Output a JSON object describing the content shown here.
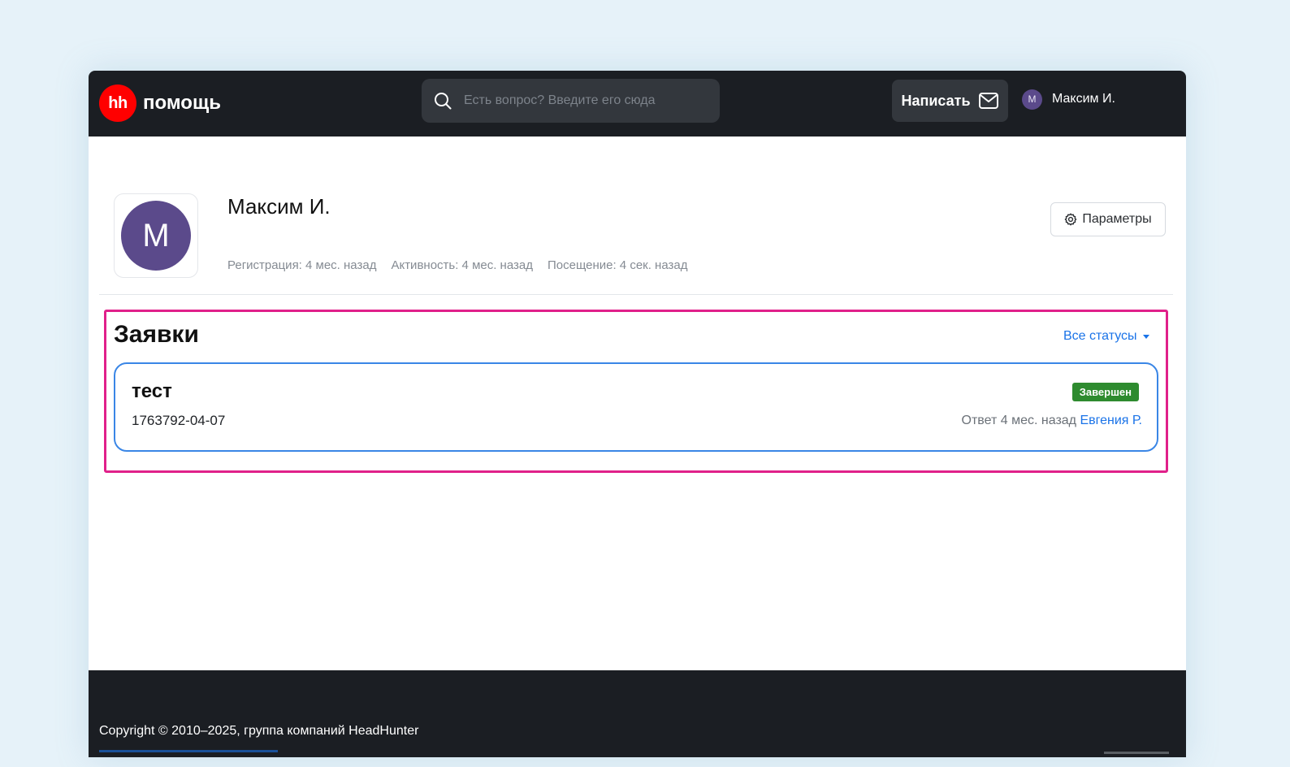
{
  "header": {
    "logo_mark": "hh",
    "logo_text": "помощь",
    "search_placeholder": "Есть вопрос? Введите его сюда",
    "write_label": "Написать",
    "user_initial": "М",
    "user_name": "Максим И."
  },
  "profile": {
    "avatar_letter": "M",
    "name": "Максим И.",
    "registration": "Регистрация: 4 мес. назад",
    "activity": "Активность: 4 мес. назад",
    "visit": "Посещение: 4 сек. назад",
    "params_label": "Параметры"
  },
  "tickets": {
    "title": "Заявки",
    "filter_label": "Все статусы",
    "items": [
      {
        "title": "тест",
        "id": "1763792-04-07",
        "status": "Завершен",
        "answer_prefix": "Ответ 4 мес. назад",
        "agent": "Евгения Р."
      }
    ]
  },
  "footer": {
    "copyright": "Copyright © 2010–2025, группа компаний HeadHunter"
  },
  "colors": {
    "brand": "#ff0000",
    "header_bg": "#1b1e23",
    "accent_link": "#1a73e8",
    "status_done": "#2e8b2f",
    "highlight": "#e0208a",
    "avatar": "#5b4a8b"
  },
  "icons": {
    "search": "search-icon",
    "mail": "mail-icon",
    "gear": "gear-icon",
    "caret": "chevron-down-icon"
  }
}
